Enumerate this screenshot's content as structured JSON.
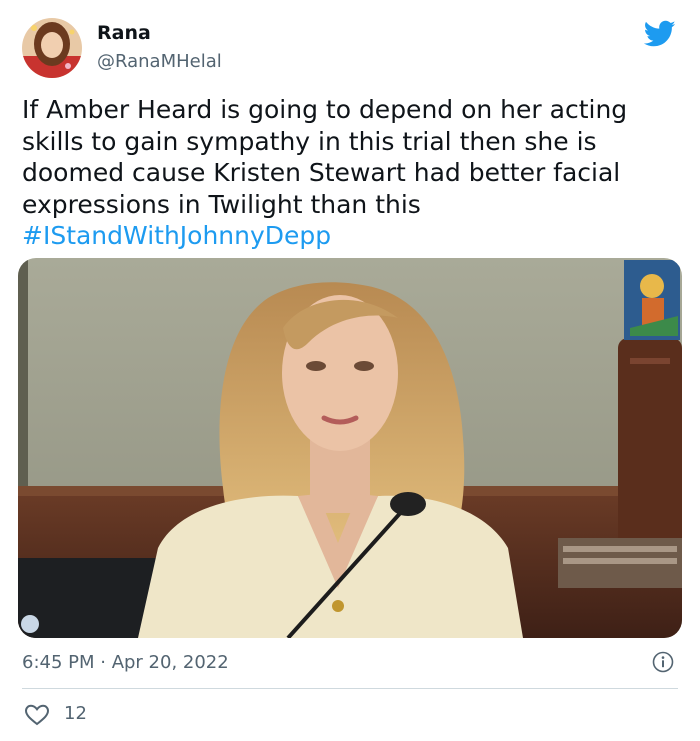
{
  "author": {
    "display_name": "Rana",
    "handle": "@RanaMHelal"
  },
  "tweet": {
    "text": "If Amber Heard is going to depend on her acting skills to gain sympathy in this trial then she is doomed cause Kristen Stewart had better facial expressions in Twilight than this",
    "hashtag": "#IStandWithJohnnyDepp"
  },
  "meta": {
    "timestamp": "6:45 PM · Apr 20, 2022"
  },
  "engagement": {
    "like_count": "12"
  },
  "icons": {
    "brand": "twitter-bird-icon",
    "info": "info-icon",
    "like": "heart-icon"
  },
  "colors": {
    "accent": "#1d9bf0",
    "text": "#0f1419",
    "muted": "#536471",
    "divider": "#cfd9de"
  }
}
